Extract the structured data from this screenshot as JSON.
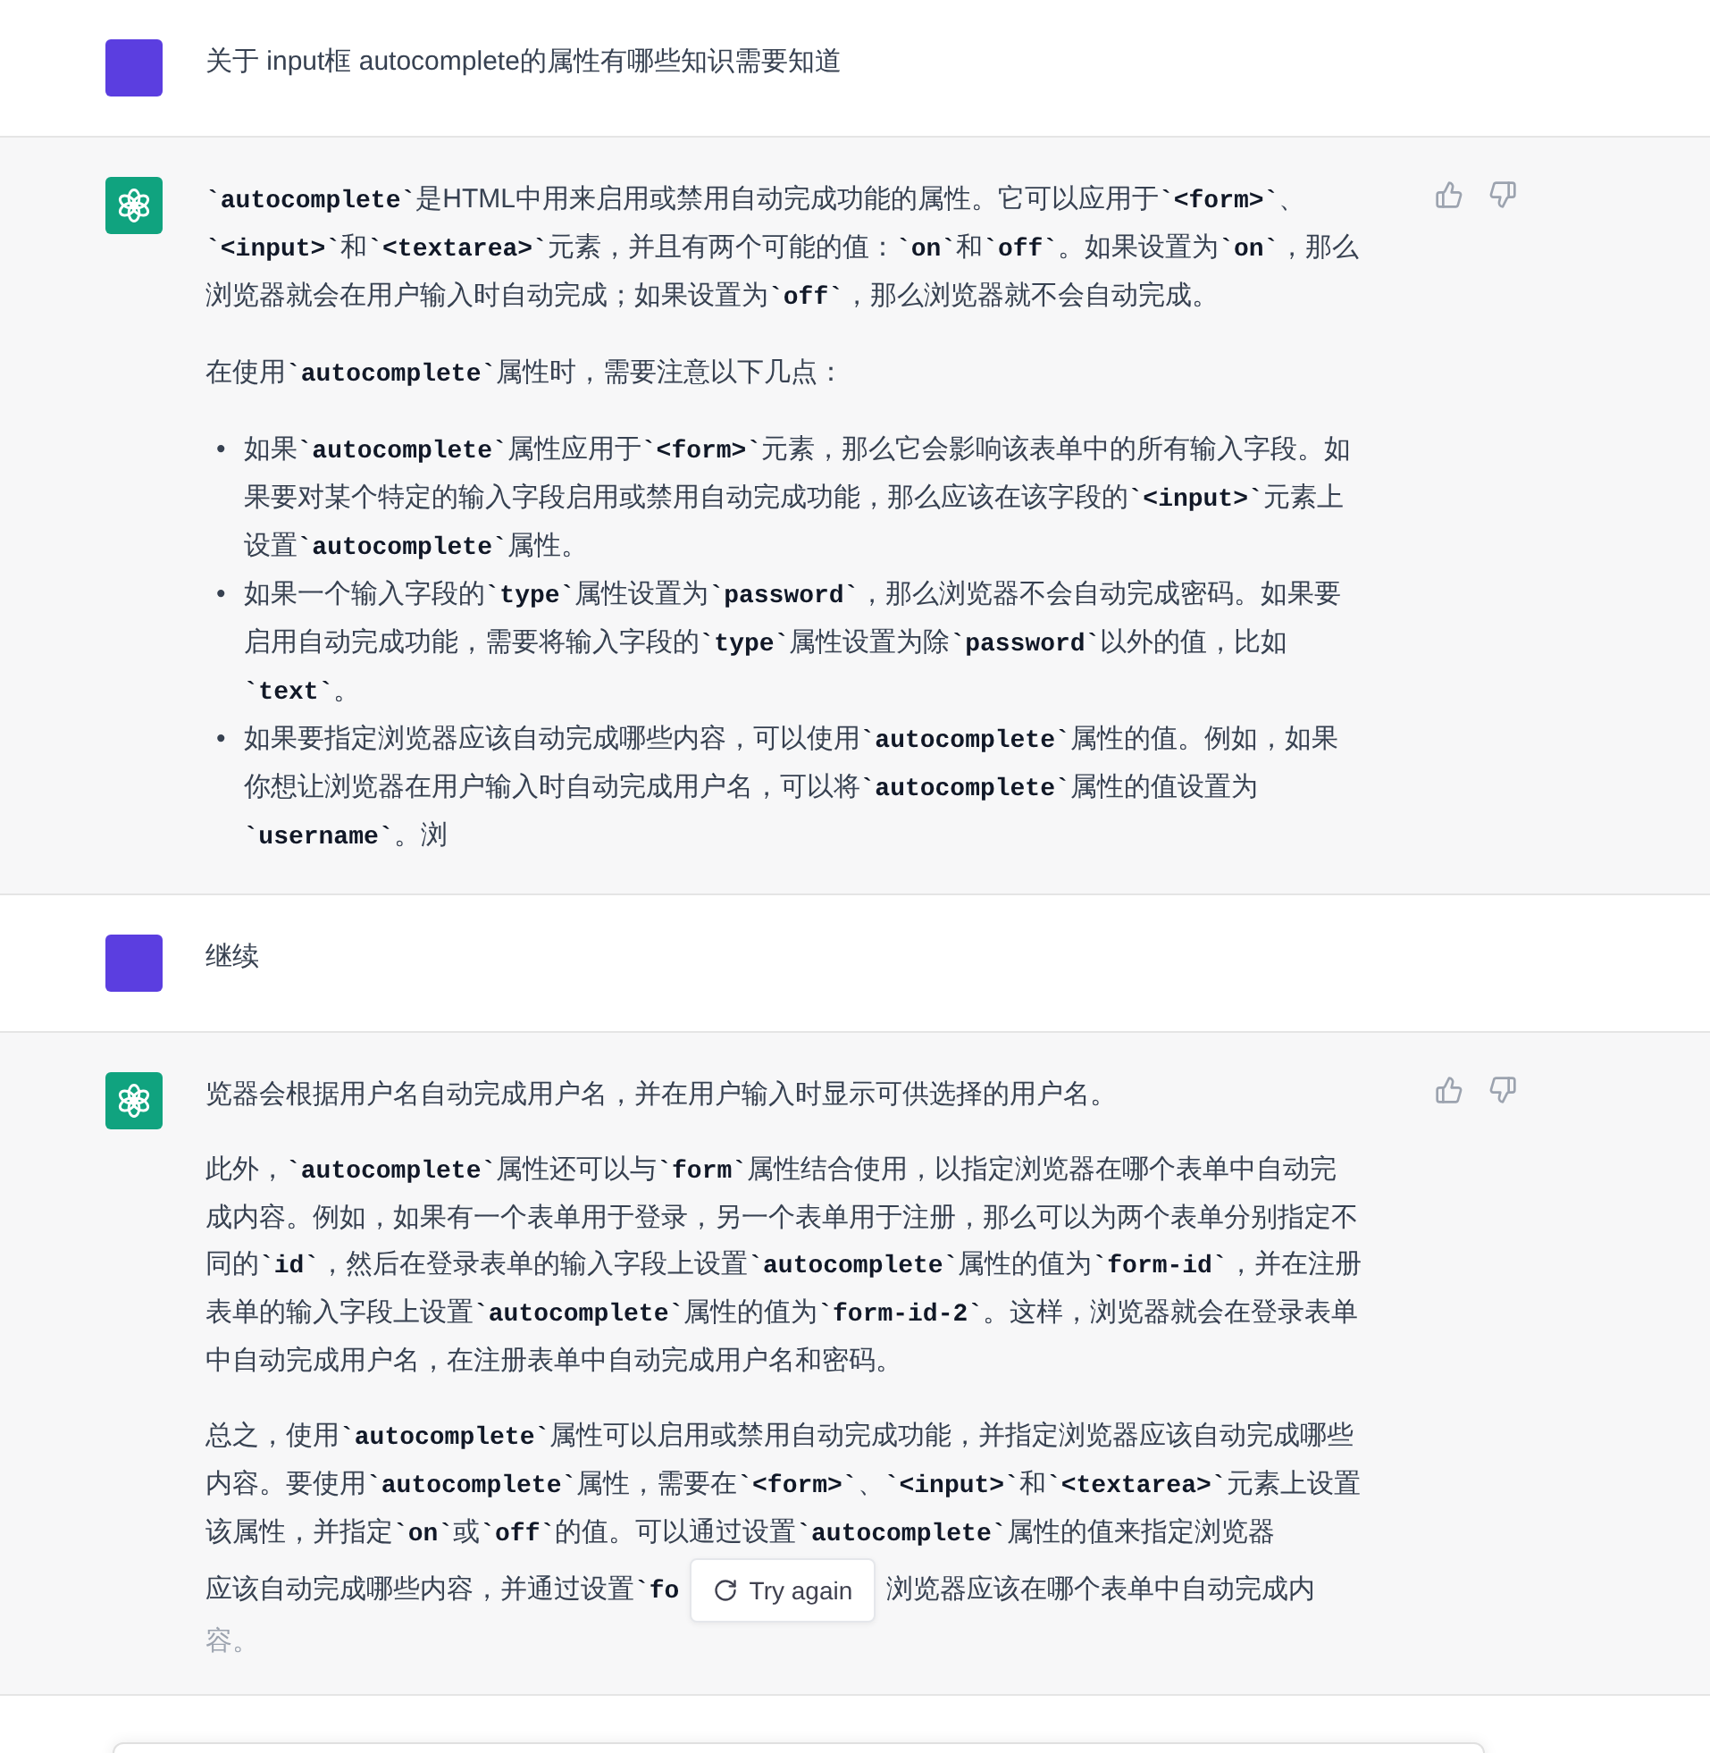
{
  "messages": [
    {
      "kind": "user",
      "blocks": [
        {
          "kind": "paragraph",
          "text": "关于 input框 autocomplete的属性有哪些知识需要知道"
        }
      ]
    },
    {
      "kind": "assistant",
      "blocks": [
        {
          "kind": "paragraph",
          "text": "**`autocomplete`**是HTML中用来启用或禁用自动完成功能的属性。它可以应用于**`<form>`**、**`<input>`**和**`<textarea>`**元素，并且有两个可能的值：**`on`**和**`off`**。如果设置为**`on`**，那么浏览器就会在用户输入时自动完成；如果设置为**`off`**，那么浏览器就不会自动完成。"
        },
        {
          "kind": "paragraph",
          "text": "在使用**`autocomplete`**属性时，需要注意以下几点："
        },
        {
          "kind": "list",
          "items": [
            {
              "marker": "•",
              "text": "如果**`autocomplete`**属性应用于**`<form>`**元素，那么它会影响该表单中的所有输入字段。如果要对某个特定的输入字段启用或禁用自动完成功能，那么应该在该字段的**`<input>`**元素上设置**`autocomplete`**属性。"
            },
            {
              "marker": "•",
              "text": "如果一个输入字段的**`type`**属性设置为**`password`**，那么浏览器不会自动完成密码。如果要启用自动完成功能，需要将输入字段的**`type`**属性设置为除**`password`**以外的值，比如**`text`**。"
            },
            {
              "marker": "•",
              "text": "如果要指定浏览器应该自动完成哪些内容，可以使用**`autocomplete`**属性的值。例如，如果你想让浏览器在用户输入时自动完成用户名，可以将**`autocomplete`**属性的值设置为**`username`**。浏"
            }
          ]
        }
      ]
    },
    {
      "kind": "user",
      "blocks": [
        {
          "kind": "paragraph",
          "text": "继续"
        }
      ]
    },
    {
      "kind": "assistant",
      "blocks": [
        {
          "kind": "paragraph",
          "text": "览器会根据用户名自动完成用户名，并在用户输入时显示可供选择的用户名。"
        },
        {
          "kind": "paragraph",
          "text": "此外，**`autocomplete`**属性还可以与**`form`**属性结合使用，以指定浏览器在哪个表单中自动完成内容。例如，如果有一个表单用于登录，另一个表单用于注册，那么可以为两个表单分别指定不同的**`id`**，然后在登录表单的输入字段上设置**`autocomplete`**属性的值为**`form-id`**，并在注册表单的输入字段上设置**`autocomplete`**属性的值为**`form-id-2`**。这样，浏览器就会在登录表单中自动完成用户名，在注册表单中自动完成用户名和密码。"
        },
        {
          "kind": "covered",
          "text": "总之，使用**`autocomplete`**属性可以启用或禁用自动完成功能，并指定浏览器应该自动完成哪些内容。要使用**`autocomplete`**属性，需要在**`<form>`**、**`<input>`**和**`<textarea>`**元素上设置该属性，并指定**`on`**或**`off`**的值。可以通过设置**`autocomplete`**属性的值来指定浏览器",
          "line": [
            "应该自动完成哪些内容，并通过设置**`fo**",
            "浏览器应该在哪个表单中自动完成内"
          ],
          "tail": "容。"
        }
      ]
    }
  ],
  "try_again_button": {
    "label": "Try again"
  }
}
